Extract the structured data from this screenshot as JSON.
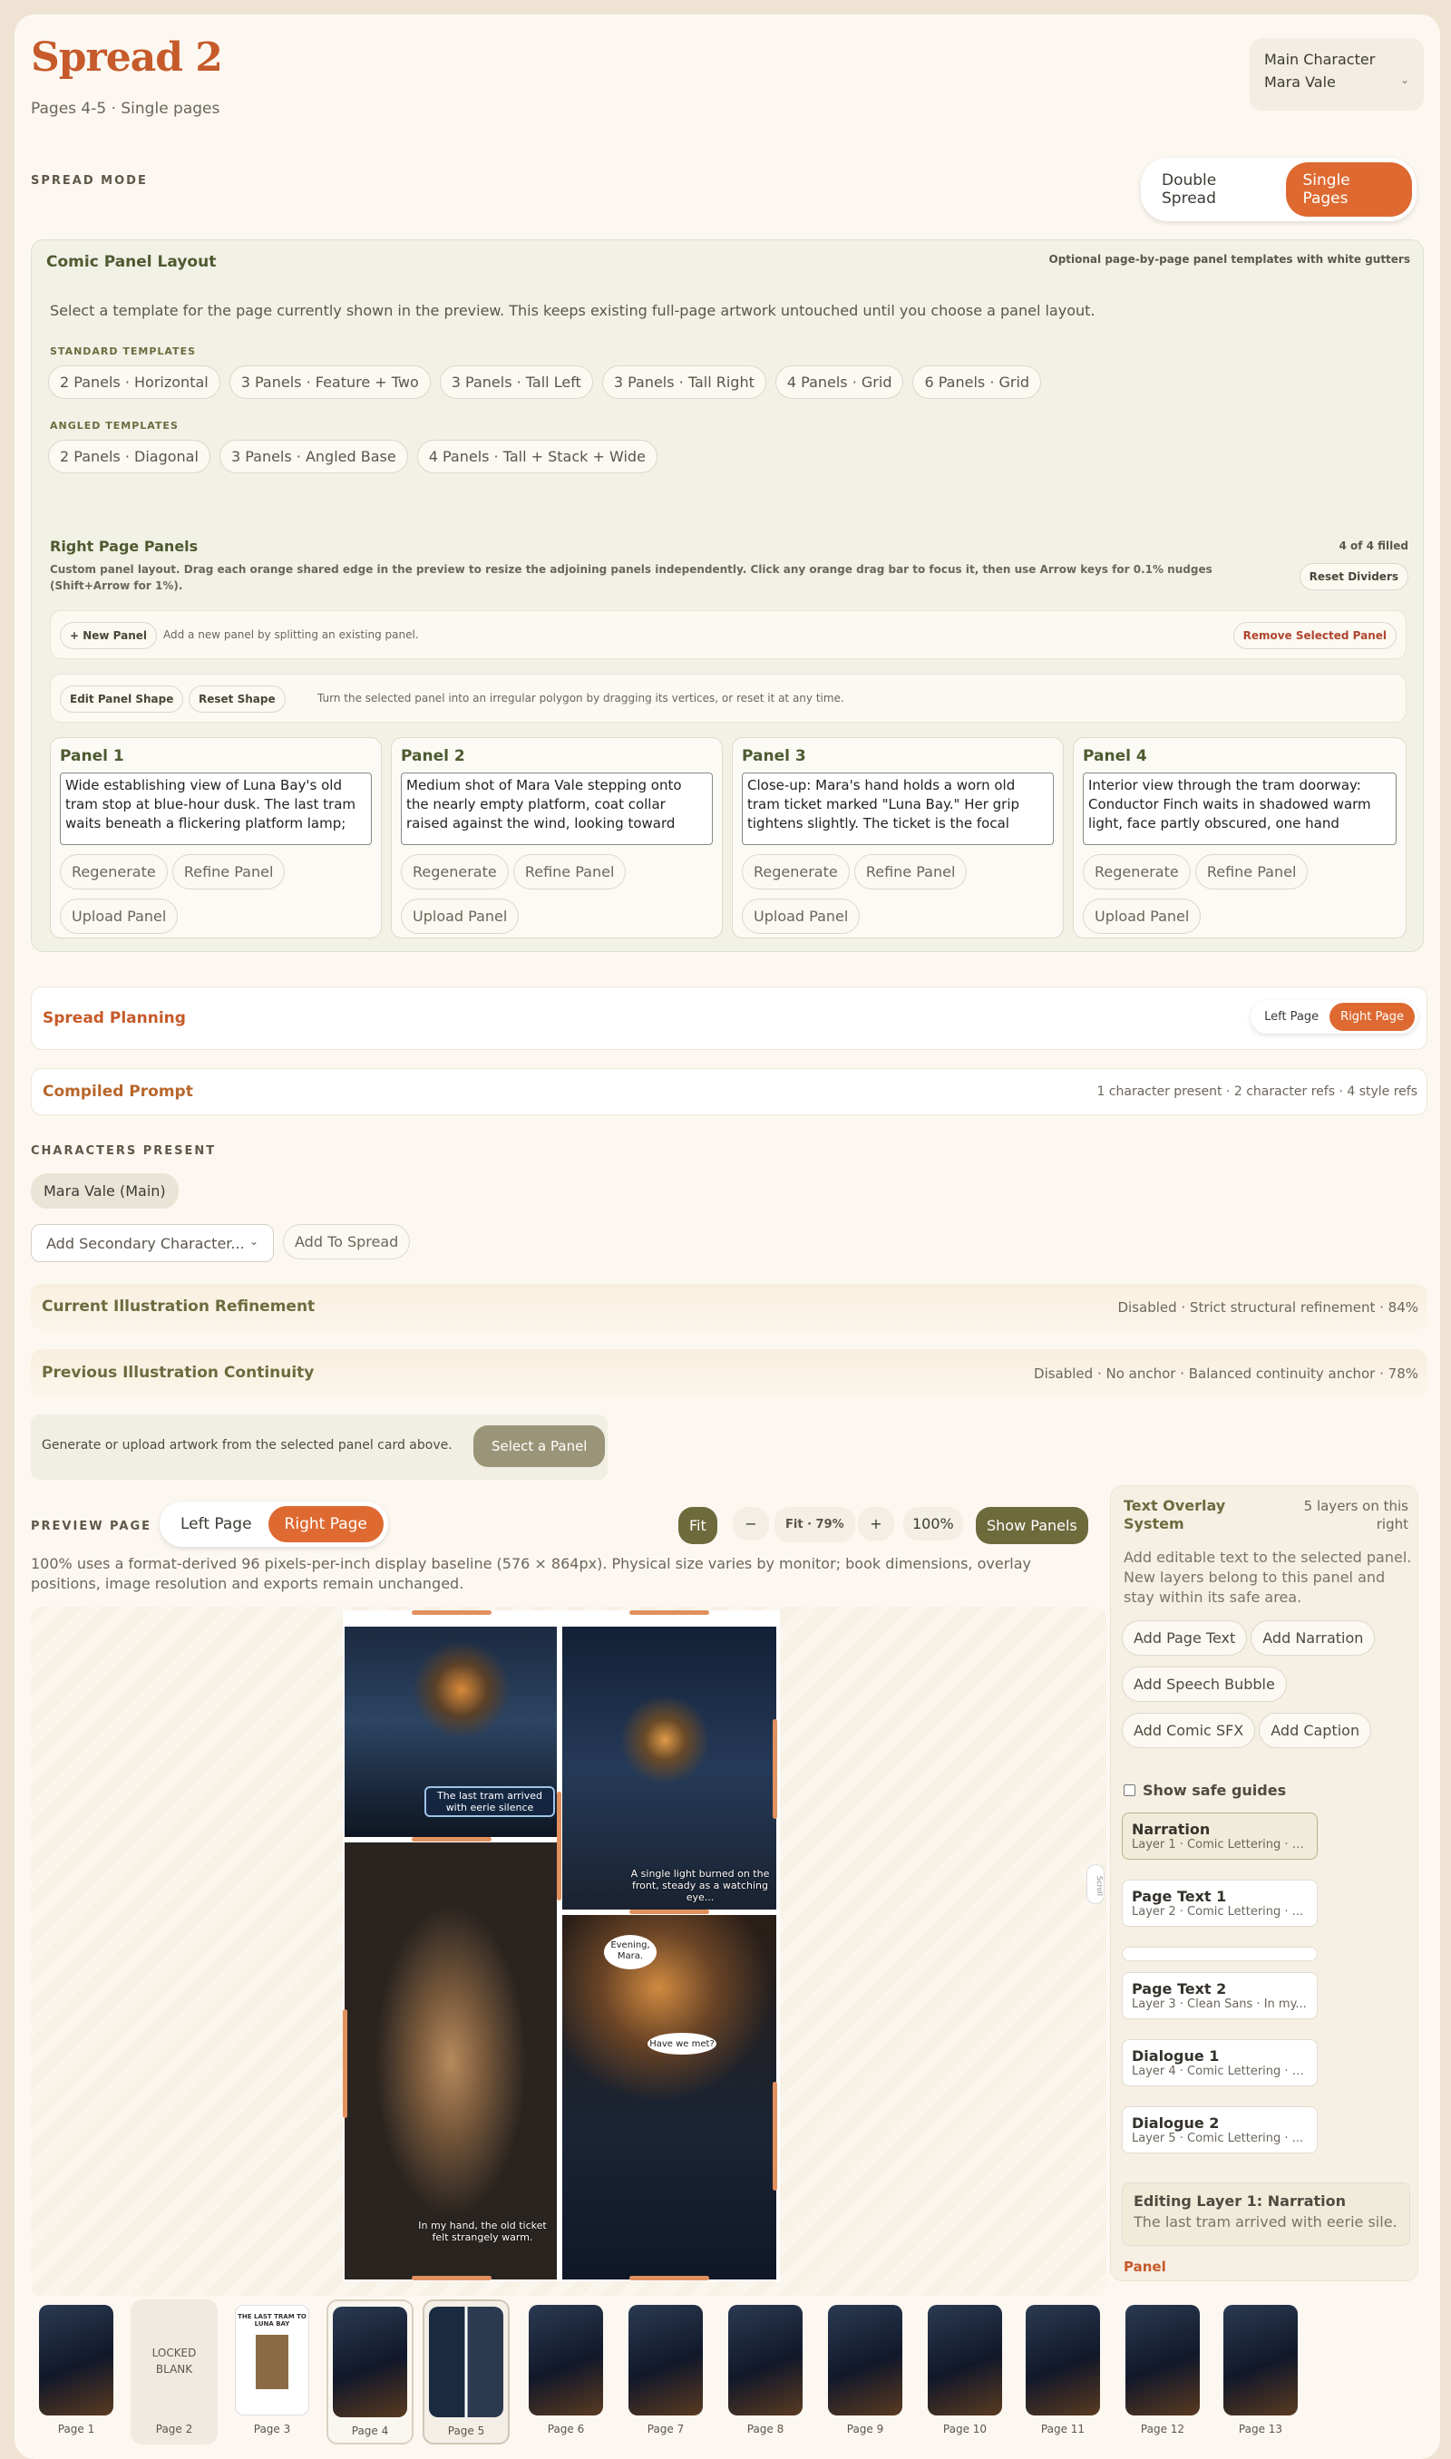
{
  "header": {
    "title": "Spread 2",
    "subtitle": "Pages 4-5 · Single pages",
    "main_char_label": "Main Character",
    "main_char_value": "Mara Vale"
  },
  "spread_mode": {
    "label": "SPREAD MODE",
    "options": [
      "Double Spread",
      "Single Pages"
    ],
    "selected": "Single Pages"
  },
  "layout": {
    "title": "Comic Panel Layout",
    "note": "Optional page-by-page panel templates with white gutters",
    "desc": "Select a template for the page currently shown in the preview. This keeps existing full-page artwork untouched until you choose a panel layout.",
    "standard_label": "STANDARD TEMPLATES",
    "standard": [
      "2 Panels · Horizontal",
      "3 Panels · Feature + Two",
      "3 Panels · Tall Left",
      "3 Panels · Tall Right",
      "4 Panels · Grid",
      "6 Panels · Grid"
    ],
    "angled_label": "ANGLED TEMPLATES",
    "angled": [
      "2 Panels · Diagonal",
      "3 Panels · Angled Base",
      "4 Panels · Tall + Stack + Wide"
    ]
  },
  "right_panels": {
    "title": "Right Page Panels",
    "filled": "4 of 4 filled",
    "desc": "Custom panel layout. Drag each orange shared edge in the preview to resize the adjoining panels independently. Click any orange drag bar to focus it, then use Arrow keys for 0.1% nudges (Shift+Arrow for 1%).",
    "reset": "Reset Dividers",
    "new_panel": "+ New Panel",
    "new_panel_desc": "Add a new panel by splitting an existing panel.",
    "remove": "Remove Selected Panel",
    "edit_shape": "Edit Panel Shape",
    "reset_shape": "Reset Shape",
    "shape_desc": "Turn the selected panel into an irregular polygon by dragging its vertices, or reset it at any time.",
    "regenerate": "Regenerate",
    "refine": "Refine Panel",
    "upload": "Upload Panel",
    "panels": [
      {
        "name": "Panel 1",
        "text": "Wide establishing view of Luna Bay's old tram stop at blue-hour dusk. The last tram waits beneath a flickering platform lamp;"
      },
      {
        "name": "Panel 2",
        "text": "Medium shot of Mara Vale stepping onto the nearly empty platform, coat collar raised against the wind, looking toward"
      },
      {
        "name": "Panel 3",
        "text": "Close-up: Mara's hand holds a worn old tram ticket marked \"Luna Bay.\" Her grip tightens slightly. The ticket is the focal"
      },
      {
        "name": "Panel 4",
        "text": "Interior view through the tram doorway: Conductor Finch waits in shadowed warm light, face partly obscured, one hand"
      }
    ]
  },
  "planning": {
    "title": "Spread Planning",
    "options": [
      "Left Page",
      "Right Page"
    ],
    "selected": "Right Page"
  },
  "compiled": {
    "title": "Compiled Prompt",
    "meta": "1 character present · 2 character refs · 4 style refs"
  },
  "characters": {
    "label": "CHARACTERS PRESENT",
    "chip": "Mara Vale (Main)",
    "select": "Add Secondary Character...",
    "add": "Add To Spread"
  },
  "refinement": {
    "title": "Current Illustration Refinement",
    "meta": "Disabled · Strict structural refinement · 84%"
  },
  "continuity": {
    "title": "Previous Illustration Continuity",
    "meta": "Disabled · No anchor · Balanced continuity anchor · 78%"
  },
  "generate": {
    "desc": "Generate or upload artwork from the selected panel card above.",
    "btn": "Select a Panel"
  },
  "preview": {
    "label": "PREVIEW PAGE",
    "left": "Left Page",
    "right": "Right Page",
    "fit": "Fit",
    "minus": "−",
    "fit_pct": "Fit · 79%",
    "plus": "+",
    "pct": "100%",
    "show_panels": "Show Panels",
    "note": "100% uses a format-derived 96 pixels-per-inch display baseline (576 × 864px). Physical size varies by monitor; book dimensions, overlay positions, image resolution and exports remain unchanged.",
    "scroll": "Scroll",
    "captions": [
      "The last tram arrived with eerie silence",
      "A single light burned on the front, steady as a watching eye...",
      "In my hand, the old ticket felt strangely warm.",
      "Evening, Mara.",
      "Have we met?"
    ]
  },
  "overlay": {
    "title": "Text Overlay System",
    "count": "5 layers on this right",
    "desc": "Add editable text to the selected panel. New layers belong to this panel and stay within its safe area.",
    "buttons": [
      "Add Page Text",
      "Add Narration",
      "Add Speech Bubble",
      "Add Comic SFX",
      "Add Caption"
    ],
    "guides": "Show safe guides",
    "layers": [
      {
        "name": "Narration",
        "meta": "Layer 1 · Comic Lettering · T..."
      },
      {
        "name": "Page Text 1",
        "meta": "Layer 2 · Comic Lettering · ..."
      },
      {
        "name": "Page Text 2",
        "meta": "Layer 3 · Clean Sans · In my..."
      },
      {
        "name": "Dialogue 1",
        "meta": "Layer 4 · Comic Lettering · E..."
      },
      {
        "name": "Dialogue 2",
        "meta": "Layer 5 · Comic Lettering · ..."
      }
    ],
    "editing_title": "Editing Layer 1: Narration",
    "editing_text": "The last tram arrived with eerie sile...",
    "panel_label": "Panel"
  },
  "thumbnails": [
    "Page 1",
    "Page 2",
    "Page 3",
    "Page 4",
    "Page 5",
    "Page 6",
    "Page 7",
    "Page 8",
    "Page 9",
    "Page 10",
    "Page 11",
    "Page 12",
    "Page 13"
  ],
  "locked": "LOCKED BLANK",
  "thumb3_title": "THE LAST TRAM TO LUNA BAY"
}
